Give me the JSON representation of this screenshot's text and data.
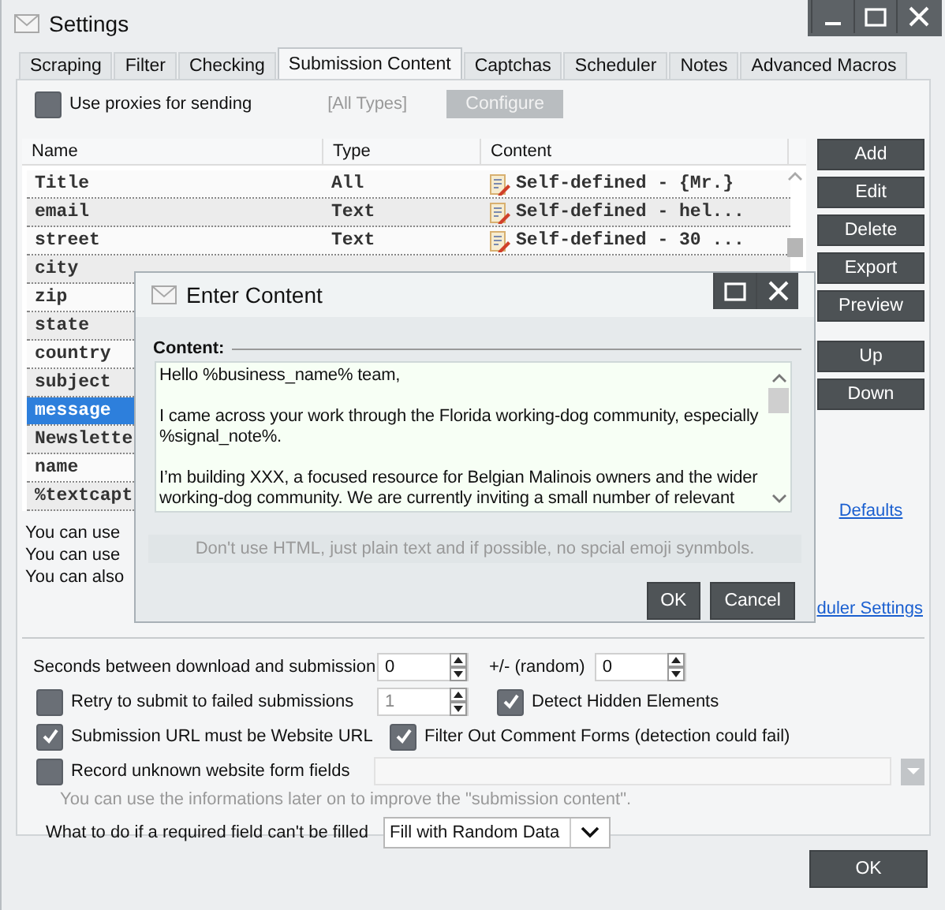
{
  "window": {
    "title": "Settings"
  },
  "tabs": [
    {
      "label": "Scraping",
      "selected": false
    },
    {
      "label": "Filter",
      "selected": false
    },
    {
      "label": "Checking",
      "selected": false
    },
    {
      "label": "Submission Content",
      "selected": true
    },
    {
      "label": "Captchas",
      "selected": false
    },
    {
      "label": "Scheduler",
      "selected": false
    },
    {
      "label": "Notes",
      "selected": false
    },
    {
      "label": "Advanced Macros",
      "selected": false
    }
  ],
  "proxies": {
    "label": "Use proxies for sending",
    "checked": false,
    "types": "[All Types]",
    "configure": "Configure"
  },
  "table": {
    "columns": [
      "Name",
      "Type",
      "Content"
    ],
    "rows": [
      {
        "name": "Title",
        "type": "All",
        "content": "Self-defined - {Mr.}",
        "selected": false
      },
      {
        "name": "email",
        "type": "Text",
        "content": "Self-defined - hel...",
        "selected": false
      },
      {
        "name": "street",
        "type": "Text",
        "content": "Self-defined - 30 ...",
        "selected": false
      },
      {
        "name": "city",
        "selected": false
      },
      {
        "name": "zip",
        "selected": false
      },
      {
        "name": "state",
        "selected": false
      },
      {
        "name": "country",
        "selected": false
      },
      {
        "name": "subject",
        "selected": false
      },
      {
        "name": "message",
        "selected": true
      },
      {
        "name": "Newslette",
        "selected": false
      },
      {
        "name": "name",
        "selected": false
      },
      {
        "name": "%textcapt",
        "selected": false
      }
    ]
  },
  "buttons": [
    "Add",
    "Edit",
    "Delete",
    "Export",
    "Preview"
  ],
  "move_buttons": [
    "Up",
    "Down"
  ],
  "defaults_link": "Defaults",
  "info_lines": [
    "You can use",
    "You can use",
    "You can also"
  ],
  "scheduler_link": "duler Settings",
  "delay": {
    "label": "Seconds between download and submission",
    "value": "0",
    "random_label": "+/- (random)",
    "random_value": "0"
  },
  "retry": {
    "label": "Retry to submit to failed submissions",
    "checked": false,
    "value": "1"
  },
  "detect_hidden": {
    "label": "Detect Hidden Elements",
    "checked": true
  },
  "submission_url": {
    "label": "Submission URL must be Website URL",
    "checked": true
  },
  "filter_comments": {
    "label": "Filter Out Comment Forms (detection could fail)",
    "checked": true
  },
  "record_unknown": {
    "label": "Record unknown website form fields",
    "checked": false
  },
  "record_hint": "You can use the informations later on to improve the \"submission content\".",
  "required_field": {
    "label": "What to do if a required field can't be filled",
    "value": "Fill with Random Data"
  },
  "ok": "OK",
  "dialog": {
    "title": "Enter Content",
    "label": "Content:",
    "text": "Hello %business_name% team,\n\nI came across your work through the Florida working-dog community, especially %signal_note%.\n\nI’m building XXX, a focused resource for Belgian Malinois owners and the wider working-dog community. We are currently inviting a small number of relevant",
    "hint": "Don't use HTML, just plain text and if possible, no spcial emoji synmbols.",
    "buttons": [
      "OK",
      "Cancel"
    ]
  }
}
